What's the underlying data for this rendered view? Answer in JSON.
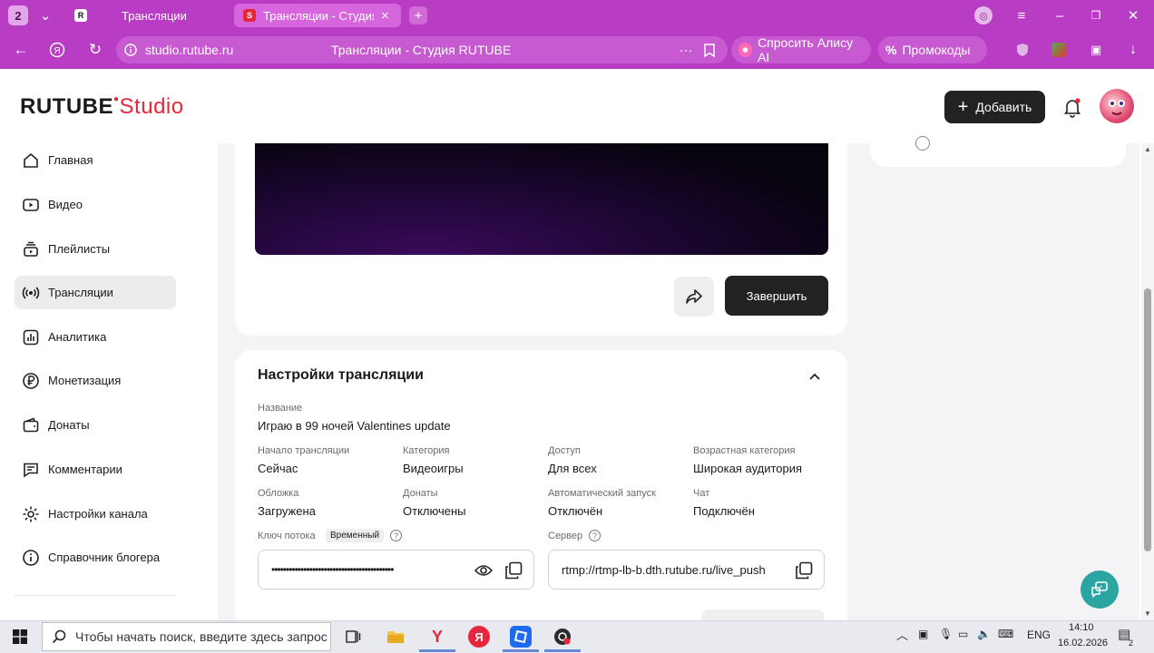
{
  "browser": {
    "tab_count": "2",
    "tabs": [
      {
        "label": "Трансляции",
        "active": false
      },
      {
        "label": "Трансляции - Студия R",
        "active": true
      }
    ],
    "url": "studio.rutube.ru",
    "page_title": "Трансляции - Студия RUTUBE",
    "alice_label": "Спросить Алису AI",
    "promo_label": "Промокоды"
  },
  "header": {
    "logo_main": "RUTUBE",
    "logo_studio": "Studio",
    "add_label": "Добавить"
  },
  "sidebar": {
    "items": [
      {
        "label": "Главная",
        "icon": "home-icon"
      },
      {
        "label": "Видео",
        "icon": "video-icon"
      },
      {
        "label": "Плейлисты",
        "icon": "playlist-icon"
      },
      {
        "label": "Трансляции",
        "icon": "broadcast-icon",
        "active": true
      },
      {
        "label": "Аналитика",
        "icon": "analytics-icon"
      },
      {
        "label": "Монетизация",
        "icon": "ruble-icon"
      },
      {
        "label": "Донаты",
        "icon": "wallet-icon"
      },
      {
        "label": "Комментарии",
        "icon": "comment-icon"
      },
      {
        "label": "Настройки канала",
        "icon": "gear-icon"
      },
      {
        "label": "Справочник блогера",
        "icon": "info-icon"
      }
    ]
  },
  "stream": {
    "end_label": "Завершить"
  },
  "settings": {
    "title": "Настройки трансляции",
    "name_label": "Название",
    "name_value": "Играю в 99 ночей Valentines update",
    "fields_row1": [
      {
        "label": "Начало трансляции",
        "value": "Сейчас"
      },
      {
        "label": "Категория",
        "value": "Видеоигры"
      },
      {
        "label": "Доступ",
        "value": "Для всех"
      },
      {
        "label": "Возрастная категория",
        "value": "Широкая аудитория"
      }
    ],
    "fields_row2": [
      {
        "label": "Обложка",
        "value": "Загружена"
      },
      {
        "label": "Донаты",
        "value": "Отключены"
      },
      {
        "label": "Автоматический запуск",
        "value": "Отключён"
      },
      {
        "label": "Чат",
        "value": "Подключён"
      }
    ],
    "stream_key_label": "Ключ потока",
    "stream_key_tag": "Временный",
    "stream_key_value": "••••••••••••••••••••••••••••••••••••••••••",
    "server_label": "Сервер",
    "server_value": "rtmp://rtmp-lb-b.dth.rutube.ru/live_push"
  },
  "taskbar": {
    "search_placeholder": "Чтобы начать поиск, введите здесь запрос",
    "lang": "ENG",
    "time": "14:10",
    "date": "16.02.2026",
    "notif_count": "2"
  },
  "colors": {
    "browser_chrome": "#b83cc4",
    "brand_red": "#e8263b",
    "dark_button": "#222222",
    "help_fab": "#2aa5a1"
  }
}
